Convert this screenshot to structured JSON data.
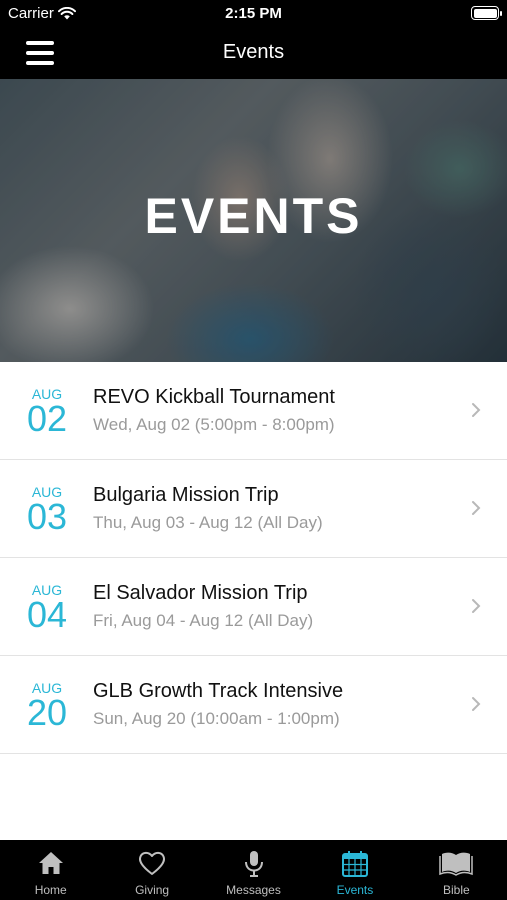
{
  "status_bar": {
    "carrier": "Carrier",
    "time": "2:15 PM"
  },
  "nav": {
    "title": "Events"
  },
  "hero": {
    "title": "EVENTS"
  },
  "events": [
    {
      "month": "AUG",
      "day": "02",
      "name": "REVO Kickball Tournament",
      "when": "Wed, Aug 02 (5:00pm - 8:00pm)"
    },
    {
      "month": "AUG",
      "day": "03",
      "name": "Bulgaria Mission Trip",
      "when": "Thu, Aug 03 - Aug 12 (All Day)"
    },
    {
      "month": "AUG",
      "day": "04",
      "name": "El Salvador Mission Trip",
      "when": "Fri, Aug 04 - Aug 12 (All Day)"
    },
    {
      "month": "AUG",
      "day": "20",
      "name": "GLB Growth Track Intensive",
      "when": "Sun, Aug 20 (10:00am - 1:00pm)"
    }
  ],
  "tabs": [
    {
      "label": "Home",
      "icon": "home-icon"
    },
    {
      "label": "Giving",
      "icon": "heart-icon"
    },
    {
      "label": "Messages",
      "icon": "microphone-icon"
    },
    {
      "label": "Events",
      "icon": "calendar-icon",
      "active": true
    },
    {
      "label": "Bible",
      "icon": "book-icon"
    }
  ],
  "colors": {
    "accent": "#2bb7d6",
    "bar_background": "#000000",
    "tab_inactive": "#bfbfbf"
  }
}
